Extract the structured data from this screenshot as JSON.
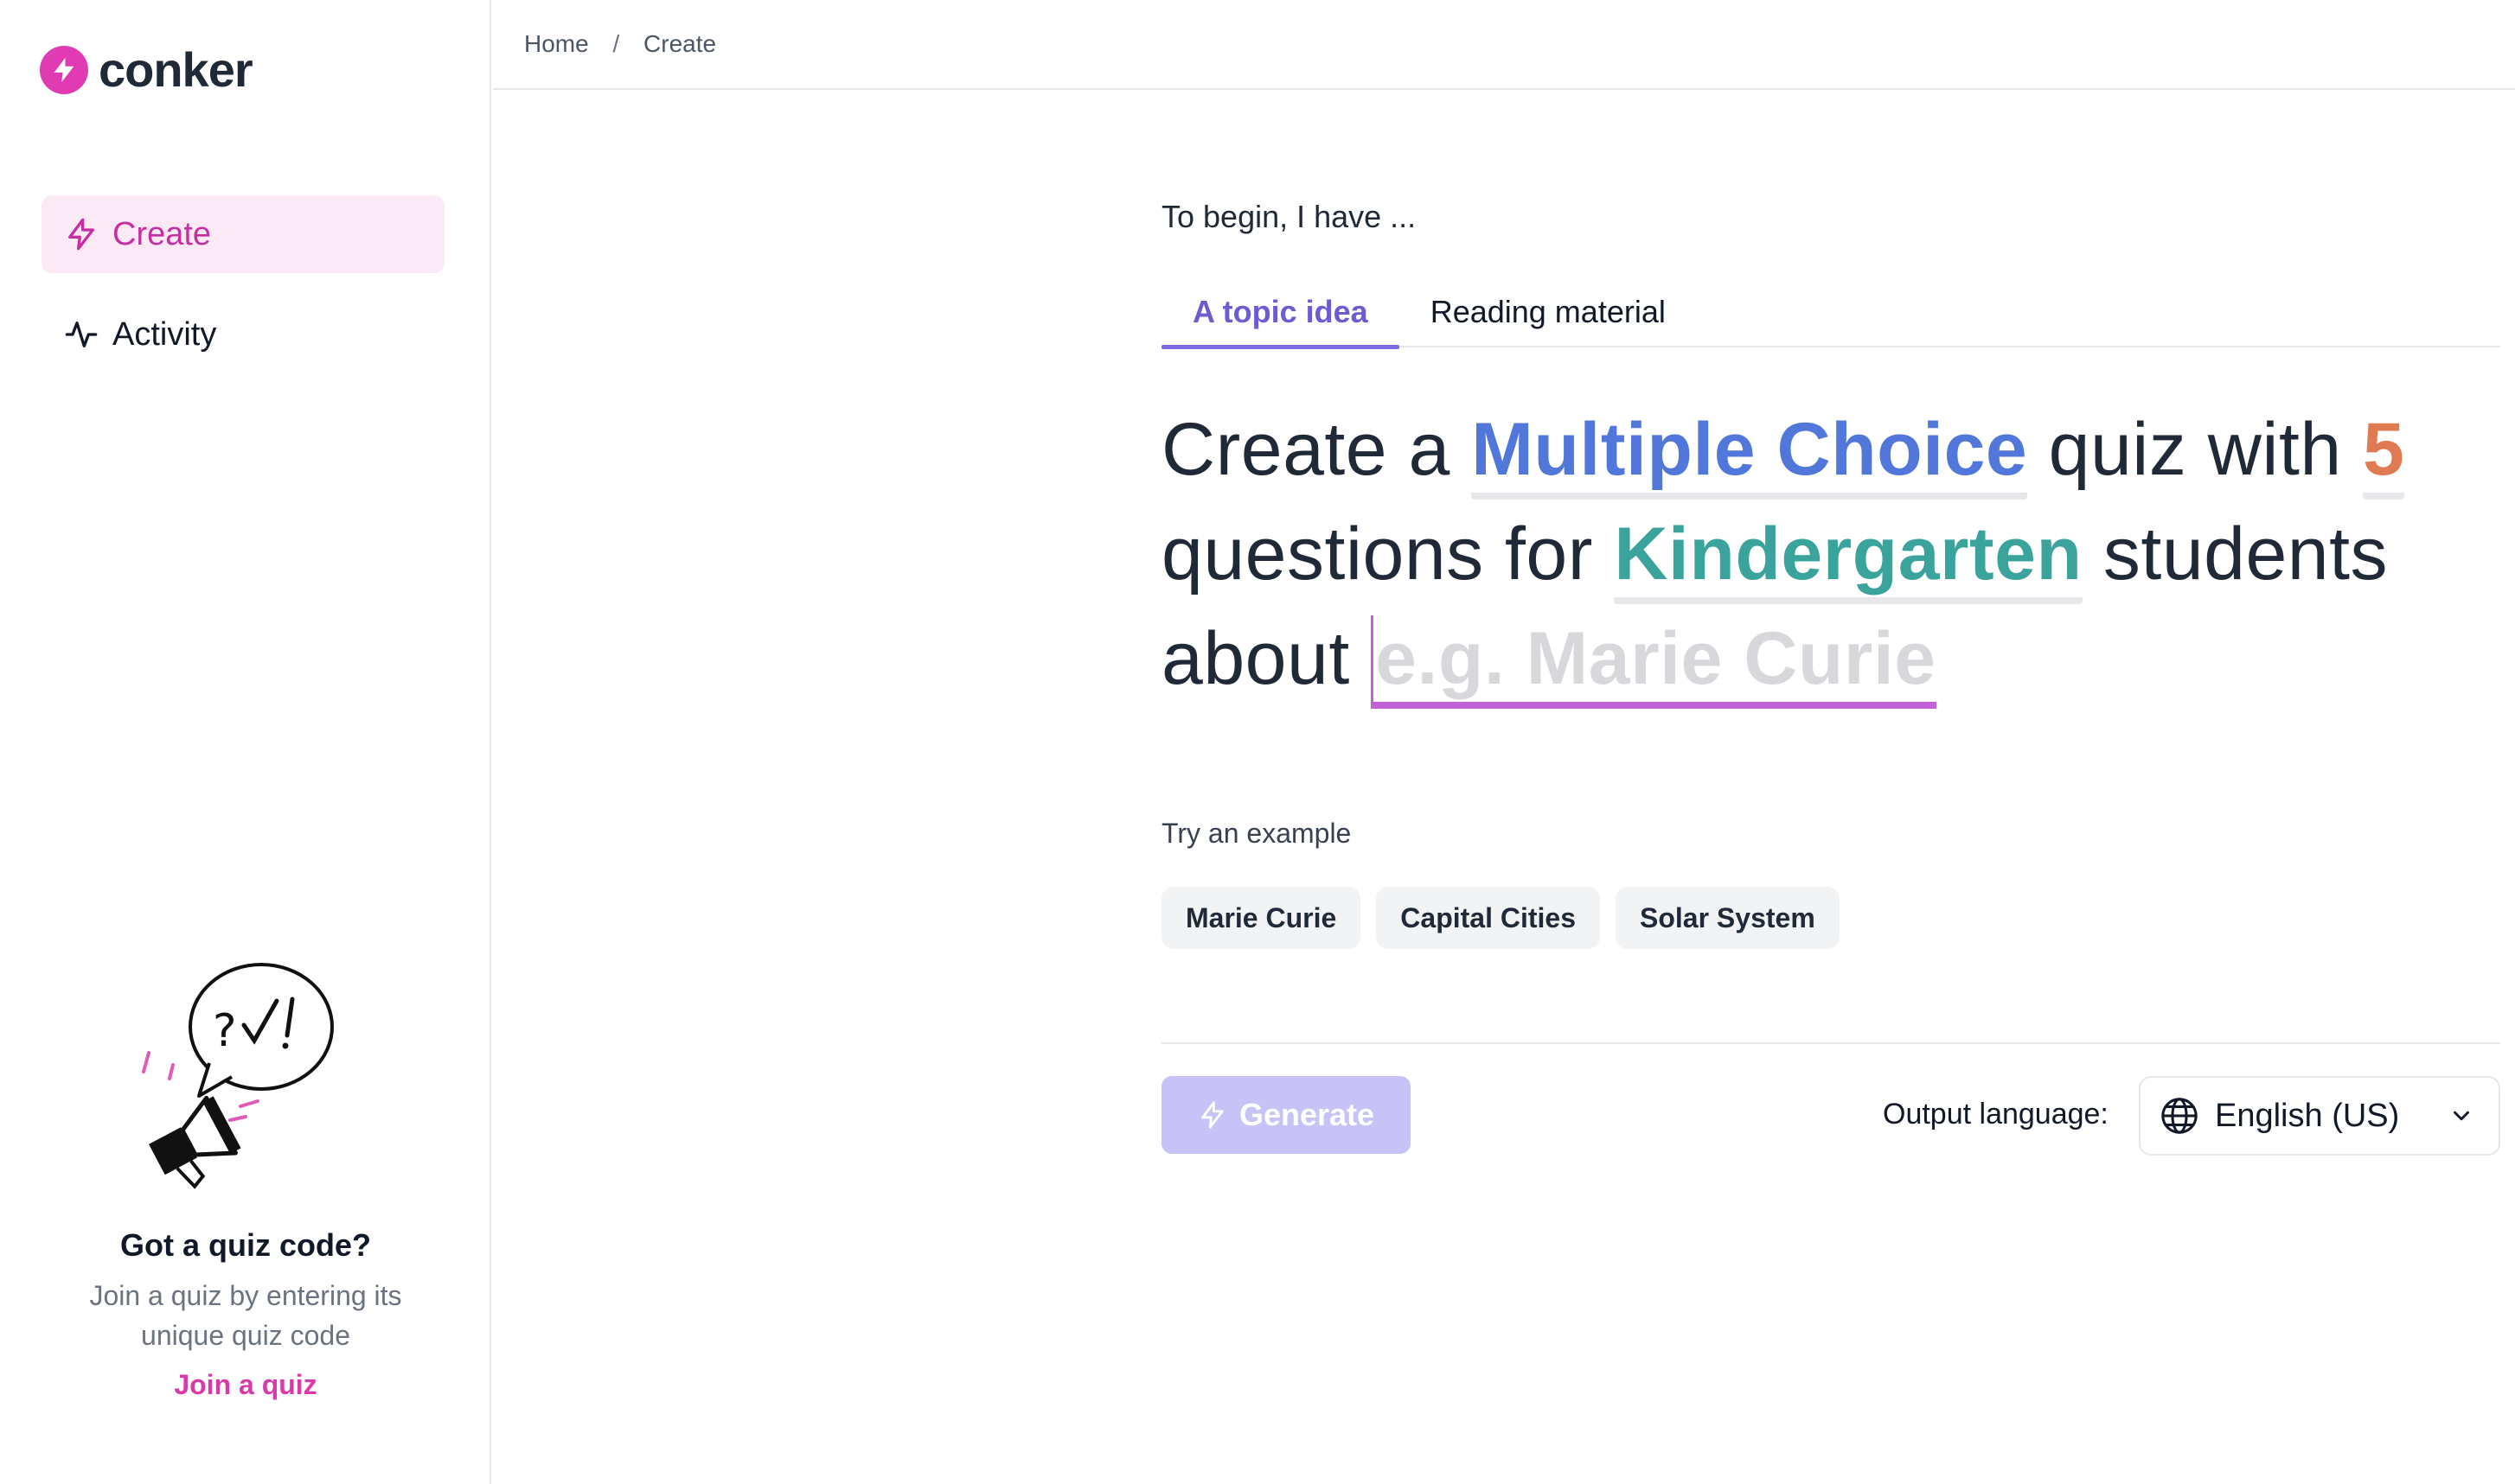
{
  "brand": {
    "name": "conker",
    "accent": "#e13bb3"
  },
  "sidebar": {
    "items": [
      {
        "label": "Create",
        "icon": "bolt-icon",
        "active": true
      },
      {
        "label": "Activity",
        "icon": "activity-icon",
        "active": false
      }
    ],
    "promo": {
      "title": "Got a quiz code?",
      "text": "Join a quiz by entering its unique quiz code",
      "link": "Join a quiz"
    }
  },
  "breadcrumb": {
    "home": "Home",
    "separator": "/",
    "current": "Create"
  },
  "main": {
    "intro": "To begin, I have ...",
    "tabs": [
      {
        "label": "A topic idea",
        "active": true
      },
      {
        "label": "Reading material",
        "active": false
      }
    ],
    "prompt": {
      "p1": "Create a",
      "question_type": "Multiple Choice",
      "p2": "quiz with",
      "count": "5",
      "p3": "questions for",
      "grade": "Kindergarten",
      "p4": "students",
      "p5": "about",
      "topic_placeholder": "e.g. Marie Curie",
      "topic_value": ""
    },
    "examples_label": "Try an example",
    "examples": [
      "Marie Curie",
      "Capital Cities",
      "Solar System"
    ],
    "generate_label": "Generate",
    "output_language_label": "Output language:",
    "output_language": "English (US)"
  }
}
